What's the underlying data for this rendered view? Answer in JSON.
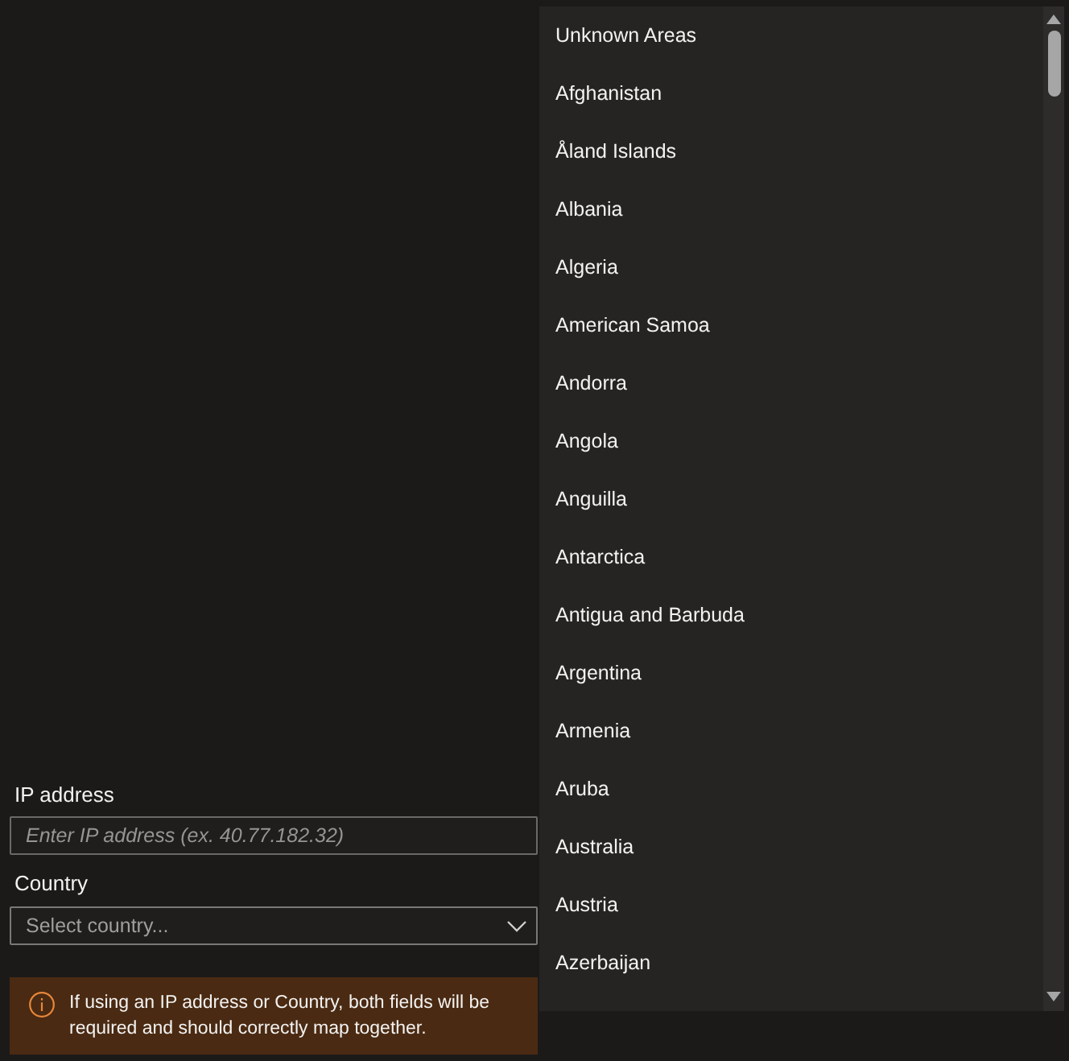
{
  "form": {
    "ip_address": {
      "label": "IP address",
      "placeholder": "Enter IP address (ex. 40.77.182.32)"
    },
    "country": {
      "label": "Country",
      "placeholder": "Select country...",
      "expanded": true
    }
  },
  "warning": {
    "text": "If using an IP address or Country, both fields will be required and should correctly map together."
  },
  "country_dropdown": {
    "options": [
      {
        "label": "Unknown Areas",
        "selected": false
      },
      {
        "label": "Afghanistan",
        "selected": false
      },
      {
        "label": "Åland Islands",
        "selected": false
      },
      {
        "label": "Albania",
        "selected": false
      },
      {
        "label": "Algeria",
        "selected": false
      },
      {
        "label": "American Samoa",
        "selected": false
      },
      {
        "label": "Andorra",
        "selected": false
      },
      {
        "label": "Angola",
        "selected": false
      },
      {
        "label": "Anguilla",
        "selected": false
      },
      {
        "label": "Antarctica",
        "selected": false
      },
      {
        "label": "Antigua and Barbuda",
        "selected": false
      },
      {
        "label": "Argentina",
        "selected": false
      },
      {
        "label": "Armenia",
        "selected": false
      },
      {
        "label": "Aruba",
        "selected": false
      },
      {
        "label": "Australia",
        "selected": false
      },
      {
        "label": "Austria",
        "selected": false
      },
      {
        "label": "Azerbaijan",
        "selected": false
      }
    ]
  }
}
